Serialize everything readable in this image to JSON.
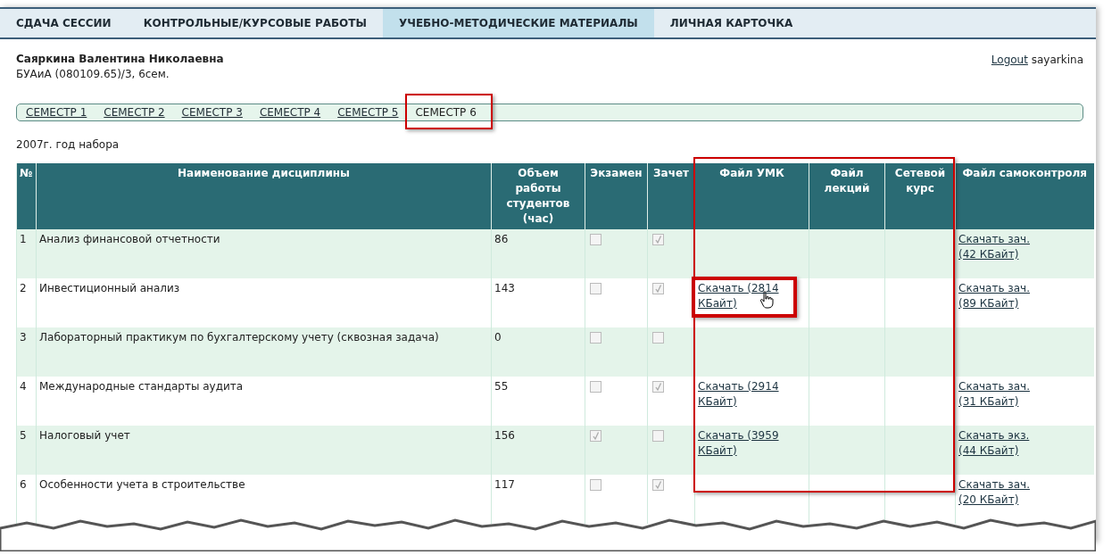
{
  "nav_tabs": [
    {
      "label": "СДАЧА СЕССИИ",
      "selected": false
    },
    {
      "label": "КОНТРОЛЬНЫЕ/КУРСОВЫЕ РАБОТЫ",
      "selected": false
    },
    {
      "label": "УЧЕБНО-МЕТОДИЧЕСКИЕ МАТЕРИАЛЫ",
      "selected": true
    },
    {
      "label": "ЛИЧНАЯ КАРТОЧКА",
      "selected": false
    }
  ],
  "user": {
    "name": "Саяркина Валентина Николаевна",
    "group": "БУАиА (080109.65)/3, 6сем."
  },
  "account": {
    "logout_link": "Logout",
    "username": "sayarkina"
  },
  "semesters": [
    {
      "label": "СЕМЕСТР 1",
      "selected": false
    },
    {
      "label": "СЕМЕСТР 2",
      "selected": false
    },
    {
      "label": "СЕМЕСТР 3",
      "selected": false
    },
    {
      "label": "СЕМЕСТР 4",
      "selected": false
    },
    {
      "label": "СЕМЕСТР 5",
      "selected": false
    },
    {
      "label": "СЕМЕСТР 6",
      "selected": true
    }
  ],
  "enrollment": "2007г. год набора",
  "table": {
    "columns": [
      "№",
      "Наименование дисциплины",
      "Объем работы студентов (час)",
      "Экзамен",
      "Зачет",
      "Файл УМК",
      "Файл лекций",
      "Сетевой курс",
      "Файл самоконтроля"
    ],
    "rows": [
      {
        "num": "1",
        "name": "Анализ финансовой отчетности",
        "hours": "86",
        "exam": false,
        "credit": true,
        "self_control": "Скачать зач. (42 КБайт)"
      },
      {
        "num": "2",
        "name": "Инвестиционный анализ",
        "hours": "143",
        "exam": false,
        "credit": true,
        "umk": "Скачать (2814 КБайт)",
        "self_control": "Скачать зач. (89 КБайт)",
        "highlighted": true
      },
      {
        "num": "3",
        "name": "Лабораторный практикум по бухгалтерскому учету (сквозная задача)",
        "hours": "0",
        "exam": false,
        "credit": false
      },
      {
        "num": "4",
        "name": "Международные стандарты аудита",
        "hours": "55",
        "exam": false,
        "credit": true,
        "umk": "Скачать (2914 КБайт)",
        "self_control": "Скачать зач. (31 КБайт)"
      },
      {
        "num": "5",
        "name": "Налоговый учет",
        "hours": "156",
        "exam": true,
        "credit": false,
        "umk": "Скачать (3959 КБайт)",
        "self_control": "Скачать экз. (44 КБайт)"
      },
      {
        "num": "6",
        "name": "Особенности учета в строительстве",
        "hours": "117",
        "exam": false,
        "credit": true,
        "self_control": "Скачать зач. (20 КБайт)"
      }
    ]
  }
}
